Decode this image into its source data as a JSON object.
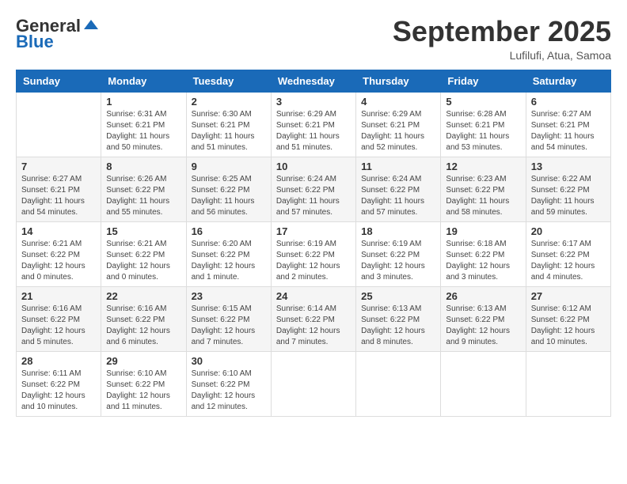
{
  "header": {
    "logo_general": "General",
    "logo_blue": "Blue",
    "month_title": "September 2025",
    "location": "Lufilufi, Atua, Samoa"
  },
  "days_of_week": [
    "Sunday",
    "Monday",
    "Tuesday",
    "Wednesday",
    "Thursday",
    "Friday",
    "Saturday"
  ],
  "weeks": [
    [
      {
        "day": "",
        "info": ""
      },
      {
        "day": "1",
        "info": "Sunrise: 6:31 AM\nSunset: 6:21 PM\nDaylight: 11 hours\nand 50 minutes."
      },
      {
        "day": "2",
        "info": "Sunrise: 6:30 AM\nSunset: 6:21 PM\nDaylight: 11 hours\nand 51 minutes."
      },
      {
        "day": "3",
        "info": "Sunrise: 6:29 AM\nSunset: 6:21 PM\nDaylight: 11 hours\nand 51 minutes."
      },
      {
        "day": "4",
        "info": "Sunrise: 6:29 AM\nSunset: 6:21 PM\nDaylight: 11 hours\nand 52 minutes."
      },
      {
        "day": "5",
        "info": "Sunrise: 6:28 AM\nSunset: 6:21 PM\nDaylight: 11 hours\nand 53 minutes."
      },
      {
        "day": "6",
        "info": "Sunrise: 6:27 AM\nSunset: 6:21 PM\nDaylight: 11 hours\nand 54 minutes."
      }
    ],
    [
      {
        "day": "7",
        "info": "Sunrise: 6:27 AM\nSunset: 6:21 PM\nDaylight: 11 hours\nand 54 minutes."
      },
      {
        "day": "8",
        "info": "Sunrise: 6:26 AM\nSunset: 6:22 PM\nDaylight: 11 hours\nand 55 minutes."
      },
      {
        "day": "9",
        "info": "Sunrise: 6:25 AM\nSunset: 6:22 PM\nDaylight: 11 hours\nand 56 minutes."
      },
      {
        "day": "10",
        "info": "Sunrise: 6:24 AM\nSunset: 6:22 PM\nDaylight: 11 hours\nand 57 minutes."
      },
      {
        "day": "11",
        "info": "Sunrise: 6:24 AM\nSunset: 6:22 PM\nDaylight: 11 hours\nand 57 minutes."
      },
      {
        "day": "12",
        "info": "Sunrise: 6:23 AM\nSunset: 6:22 PM\nDaylight: 11 hours\nand 58 minutes."
      },
      {
        "day": "13",
        "info": "Sunrise: 6:22 AM\nSunset: 6:22 PM\nDaylight: 11 hours\nand 59 minutes."
      }
    ],
    [
      {
        "day": "14",
        "info": "Sunrise: 6:21 AM\nSunset: 6:22 PM\nDaylight: 12 hours\nand 0 minutes."
      },
      {
        "day": "15",
        "info": "Sunrise: 6:21 AM\nSunset: 6:22 PM\nDaylight: 12 hours\nand 0 minutes."
      },
      {
        "day": "16",
        "info": "Sunrise: 6:20 AM\nSunset: 6:22 PM\nDaylight: 12 hours\nand 1 minute."
      },
      {
        "day": "17",
        "info": "Sunrise: 6:19 AM\nSunset: 6:22 PM\nDaylight: 12 hours\nand 2 minutes."
      },
      {
        "day": "18",
        "info": "Sunrise: 6:19 AM\nSunset: 6:22 PM\nDaylight: 12 hours\nand 3 minutes."
      },
      {
        "day": "19",
        "info": "Sunrise: 6:18 AM\nSunset: 6:22 PM\nDaylight: 12 hours\nand 3 minutes."
      },
      {
        "day": "20",
        "info": "Sunrise: 6:17 AM\nSunset: 6:22 PM\nDaylight: 12 hours\nand 4 minutes."
      }
    ],
    [
      {
        "day": "21",
        "info": "Sunrise: 6:16 AM\nSunset: 6:22 PM\nDaylight: 12 hours\nand 5 minutes."
      },
      {
        "day": "22",
        "info": "Sunrise: 6:16 AM\nSunset: 6:22 PM\nDaylight: 12 hours\nand 6 minutes."
      },
      {
        "day": "23",
        "info": "Sunrise: 6:15 AM\nSunset: 6:22 PM\nDaylight: 12 hours\nand 7 minutes."
      },
      {
        "day": "24",
        "info": "Sunrise: 6:14 AM\nSunset: 6:22 PM\nDaylight: 12 hours\nand 7 minutes."
      },
      {
        "day": "25",
        "info": "Sunrise: 6:13 AM\nSunset: 6:22 PM\nDaylight: 12 hours\nand 8 minutes."
      },
      {
        "day": "26",
        "info": "Sunrise: 6:13 AM\nSunset: 6:22 PM\nDaylight: 12 hours\nand 9 minutes."
      },
      {
        "day": "27",
        "info": "Sunrise: 6:12 AM\nSunset: 6:22 PM\nDaylight: 12 hours\nand 10 minutes."
      }
    ],
    [
      {
        "day": "28",
        "info": "Sunrise: 6:11 AM\nSunset: 6:22 PM\nDaylight: 12 hours\nand 10 minutes."
      },
      {
        "day": "29",
        "info": "Sunrise: 6:10 AM\nSunset: 6:22 PM\nDaylight: 12 hours\nand 11 minutes."
      },
      {
        "day": "30",
        "info": "Sunrise: 6:10 AM\nSunset: 6:22 PM\nDaylight: 12 hours\nand 12 minutes."
      },
      {
        "day": "",
        "info": ""
      },
      {
        "day": "",
        "info": ""
      },
      {
        "day": "",
        "info": ""
      },
      {
        "day": "",
        "info": ""
      }
    ]
  ]
}
